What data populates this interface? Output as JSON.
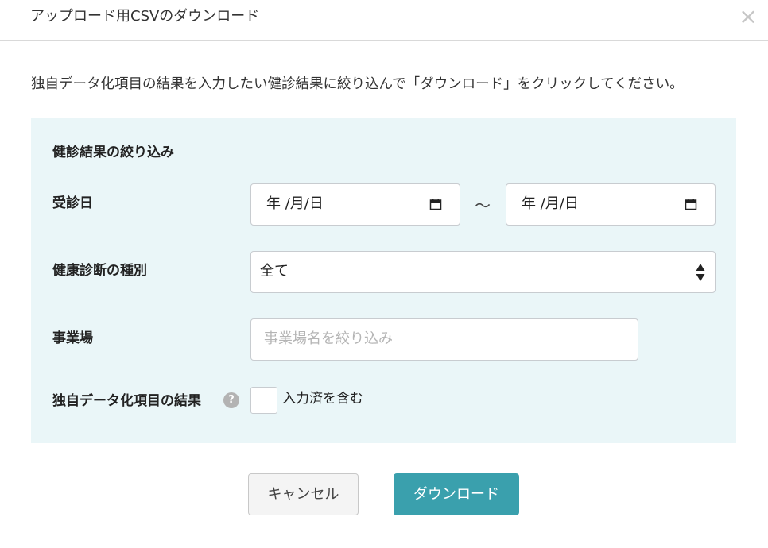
{
  "dialog": {
    "title": "アップロード用CSVのダウンロード",
    "close_glyph": "×",
    "instruction": "独自データ化項目の結果を入力したい健診結果に絞り込んで「ダウンロード」をクリックしてください。"
  },
  "filter": {
    "title": "健診結果の絞り込み",
    "visit_date": {
      "label": "受診日",
      "from_value": "年 /月/日",
      "to_value": "年 /月/日",
      "separator": "～"
    },
    "checkup_type": {
      "label": "健康診断の種別",
      "selected": "全て"
    },
    "workplace": {
      "label": "事業場",
      "placeholder": "事業場名を絞り込み"
    },
    "custom_result": {
      "label": "独自データ化項目の結果",
      "help_glyph": "?",
      "checkbox_label": "入力済を含む",
      "checked": false
    }
  },
  "buttons": {
    "cancel": "キャンセル",
    "download": "ダウンロード"
  },
  "colors": {
    "panel_bg": "#eaf6f8",
    "primary": "#3aa0ad"
  },
  "icons": {
    "close": "close-icon",
    "calendar": "calendar-icon",
    "select": "select-arrows-icon",
    "help": "help-icon"
  }
}
